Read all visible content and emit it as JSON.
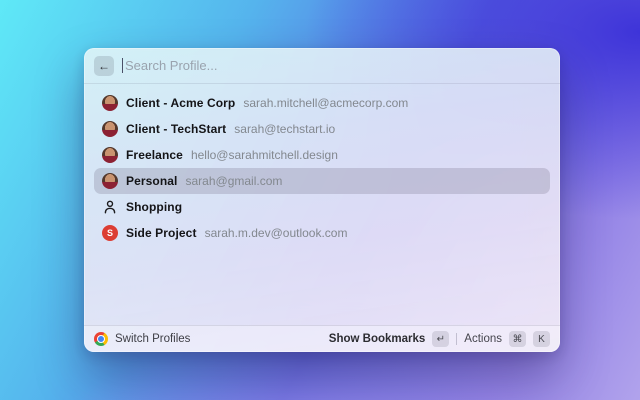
{
  "search": {
    "placeholder": "Search Profile...",
    "back_icon": "←"
  },
  "profiles": [
    {
      "name": "Client - Acme Corp",
      "email": "sarah.mitchell@acmecorp.com",
      "avatar": "photo",
      "selected": false
    },
    {
      "name": "Client - TechStart",
      "email": "sarah@techstart.io",
      "avatar": "photo",
      "selected": false
    },
    {
      "name": "Freelance",
      "email": "hello@sarahmitchell.design",
      "avatar": "photo",
      "selected": false
    },
    {
      "name": "Personal",
      "email": "sarah@gmail.com",
      "avatar": "photo",
      "selected": true
    },
    {
      "name": "Shopping",
      "email": "",
      "avatar": "person-icon",
      "selected": false
    },
    {
      "name": "Side Project",
      "email": "sarah.m.dev@outlook.com",
      "avatar": "letter",
      "letter": "S",
      "letter_bg": "#dc3d33",
      "selected": false
    }
  ],
  "footer": {
    "app_icon": "chrome-logo",
    "left_label": "Switch Profiles",
    "primary_action": "Show Bookmarks",
    "primary_key": "↵",
    "secondary_action": "Actions",
    "secondary_keys": [
      "⌘",
      "K"
    ]
  },
  "colors": {
    "bg_top_left": "#5fe9f7",
    "bg_top_right": "#3a30d8",
    "bg_bottom": "#a392ea",
    "panel_tint_top": "#e1f4f6",
    "panel_tint_bottom": "#f3edf7",
    "selected_row": "rgba(122,118,143,0.28)",
    "letter_avatar_bg": "#dc3d33",
    "name_text": "#141417",
    "email_text": "#83888f"
  }
}
